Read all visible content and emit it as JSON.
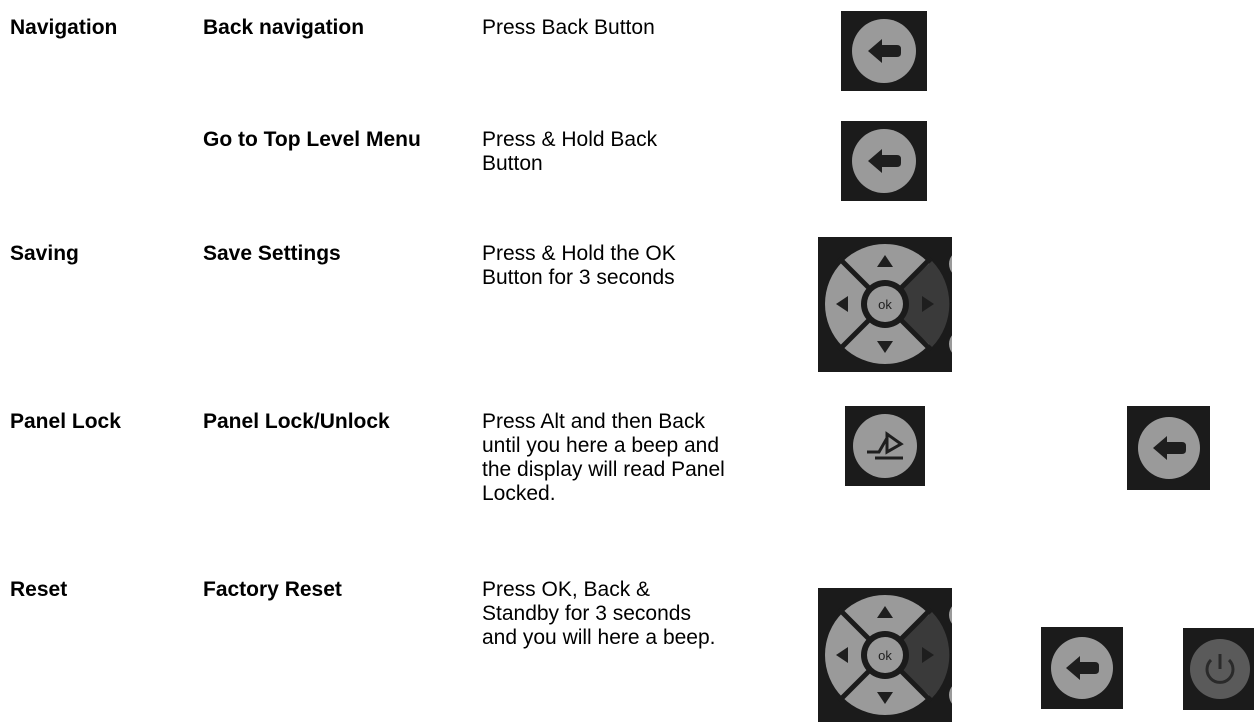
{
  "rows": [
    {
      "category": "Navigation",
      "action": "Back navigation",
      "description": "Press Back Button",
      "buttons": [
        "back-button"
      ]
    },
    {
      "category": "",
      "action": "Go to Top Level Menu",
      "description": "Press & Hold Back Button",
      "buttons": [
        "back-button"
      ]
    },
    {
      "category": "Saving",
      "action": "Save Settings",
      "description": "Press & Hold the OK Button for 3 seconds",
      "buttons": [
        "ok-dpad"
      ]
    },
    {
      "category": "Panel Lock",
      "action": "Panel Lock/Unlock",
      "description": "Press Alt and then Back until you here a beep and the display will read Panel Locked.",
      "buttons": [
        "alt-button",
        "back-button"
      ]
    },
    {
      "category": "Reset",
      "action": "Factory Reset",
      "description": "Press OK, Back & Standby for 3 seconds and you will here a beep.",
      "buttons": [
        "ok-dpad",
        "back-button",
        "standby-button"
      ]
    }
  ],
  "dpad_center_label": "ok",
  "colors": {
    "tile_bg": "#1b1b1b",
    "button_face": "#9a9a9a",
    "button_dark": "#3a3a3a",
    "icon_ink": "#1e1e1e"
  }
}
